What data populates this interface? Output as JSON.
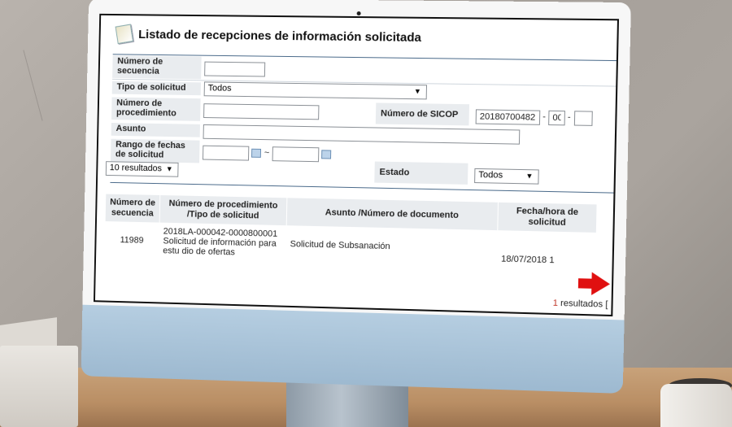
{
  "page": {
    "title": "Listado de recepciones de información solicitada"
  },
  "form": {
    "numero_secuencia": {
      "label": "Número de secuencia",
      "value": ""
    },
    "tipo_solicitud": {
      "label": "Tipo de solicitud",
      "selected": "Todos"
    },
    "numero_procedimiento": {
      "label": "Número de procedimiento",
      "value": ""
    },
    "numero_sicop": {
      "label": "Número de SICOP",
      "part1": "20180700482",
      "part2": "00",
      "part3": "",
      "sep": "-"
    },
    "asunto": {
      "label": "Asunto",
      "value": ""
    },
    "rango_fechas": {
      "label": "Rango de fechas de solicitud",
      "from": "",
      "to": "",
      "sep": "~"
    },
    "page_size": {
      "selected": "10 resultados"
    },
    "estado": {
      "label": "Estado",
      "selected": "Todos"
    }
  },
  "table": {
    "headers": [
      "Número de secuencia",
      "Número de procedimiento /Tipo de solicitud",
      "Asunto /Número de documento",
      "Fecha/hora de solicitud"
    ],
    "rows": [
      {
        "secuencia": "11989",
        "procedimiento": "2018LA-000042-0000800001",
        "tipo": "Solicitud de información para estu dio de ofertas",
        "asunto": "Solicitud de Subsanación",
        "fecha": "18/07/2018 1"
      }
    ]
  },
  "footer": {
    "count": "1",
    "suffix": " resultados ["
  },
  "icons": {
    "title": "document-icon",
    "calendar": "calendar-icon",
    "arrow": "red-arrow-icon"
  },
  "colors": {
    "arrow": "#e01010",
    "count": "#c0392b"
  }
}
